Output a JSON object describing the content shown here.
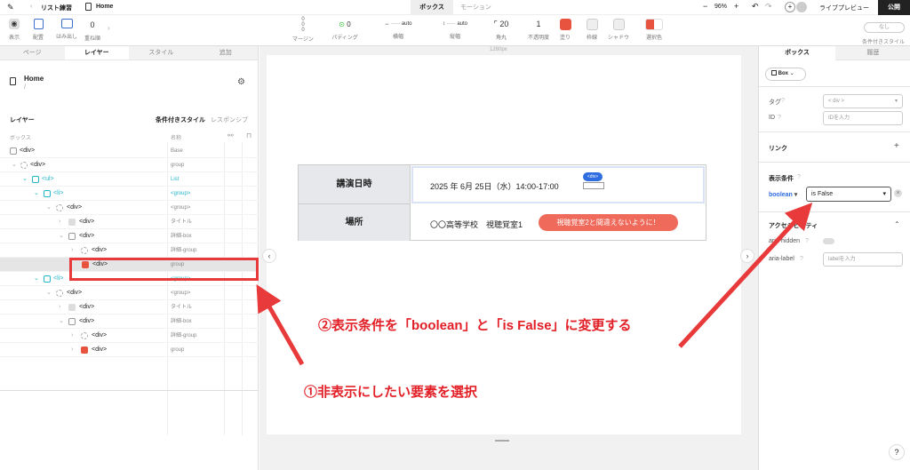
{
  "topbar": {
    "breadcrumb1": "リスト練習",
    "breadcrumb2": "Home",
    "tab_box": "ボックス",
    "tab_motion": "モーション",
    "zoom": "96%",
    "live_preview": "ライブプレビュー",
    "publish": "公開"
  },
  "toolbar": {
    "display": "表示",
    "position": "配置",
    "overflow": "はみ出し",
    "overflow_val": "0",
    "stack": "重ね順",
    "margin": "マージン",
    "margin_top": "0",
    "margin_mid": "0",
    "margin_bottom": "0",
    "padding": "パディング",
    "padding_val": "0",
    "width": "横幅",
    "width_val": "auto",
    "height": "縦幅",
    "height_val": "auto",
    "radius": "角丸",
    "radius_val": "20",
    "opacity": "不透明度",
    "opacity_val": "1",
    "fill": "塗り",
    "border": "枠線",
    "shadow": "シャドウ",
    "select_color": "選択色",
    "cond_style": "条件付きスタイル",
    "none": "なし"
  },
  "left": {
    "tabs": [
      "ページ",
      "レイヤー",
      "スタイル",
      "追加"
    ],
    "page_title": "Home",
    "page_path": "/",
    "layer_heading": "レイヤー",
    "cond_style_tab": "条件付きスタイル",
    "responsive_tab": "レスポンシブ",
    "col_box": "ボックス",
    "col_name": "名称",
    "rows": [
      {
        "tag": "<div>",
        "name": "Base"
      },
      {
        "tag": "<div>",
        "name": "group"
      },
      {
        "tag": "<ul>",
        "name": "List"
      },
      {
        "tag": "<li>",
        "name": "<group>"
      },
      {
        "tag": "<div>",
        "name": "<group>"
      },
      {
        "tag": "<div>",
        "name": "タイトル"
      },
      {
        "tag": "<div>",
        "name": "詳細-box"
      },
      {
        "tag": "<div>",
        "name": "詳細-group"
      },
      {
        "tag": "<div>",
        "name": "group"
      },
      {
        "tag": "<li>",
        "name": "<group>"
      },
      {
        "tag": "<div>",
        "name": "<group>"
      },
      {
        "tag": "<div>",
        "name": "タイトル"
      },
      {
        "tag": "<div>",
        "name": "詳細-box"
      },
      {
        "tag": "<div>",
        "name": "詳細-group"
      },
      {
        "tag": "<div>",
        "name": "group"
      }
    ]
  },
  "canvas": {
    "width_label": "1280px",
    "row1_label": "講演日時",
    "row1_value": "2025 年 6月 25日（水）14:00-17:00",
    "div_badge": "<div>",
    "row2_label": "場所",
    "row2_value": "〇〇高等学校　視聴覚室1",
    "row2_button": "視聴覚室2と間違えないように！"
  },
  "right": {
    "tab_box": "ボックス",
    "tab_history": "履歴",
    "component": "Box",
    "tag_label": "タグ",
    "tag_value": "< div >",
    "id_label": "ID",
    "id_placeholder": "IDを入力",
    "link_label": "リンク",
    "cond_label": "表示条件",
    "cond_var": "boolean",
    "cond_value": "is False",
    "access_label": "アクセシビリティ",
    "aria_hidden": "aria-hidden",
    "aria_label": "aria-label",
    "label_placeholder": "labelを入力"
  },
  "annotations": {
    "step1": "①非表示にしたい要素を選択",
    "step2": "②表示条件を「boolean」と「is False」に変更する"
  },
  "colors": {
    "accent": "#21b6c8",
    "annotation": "#e21f26",
    "button": "#ef6a5a"
  }
}
